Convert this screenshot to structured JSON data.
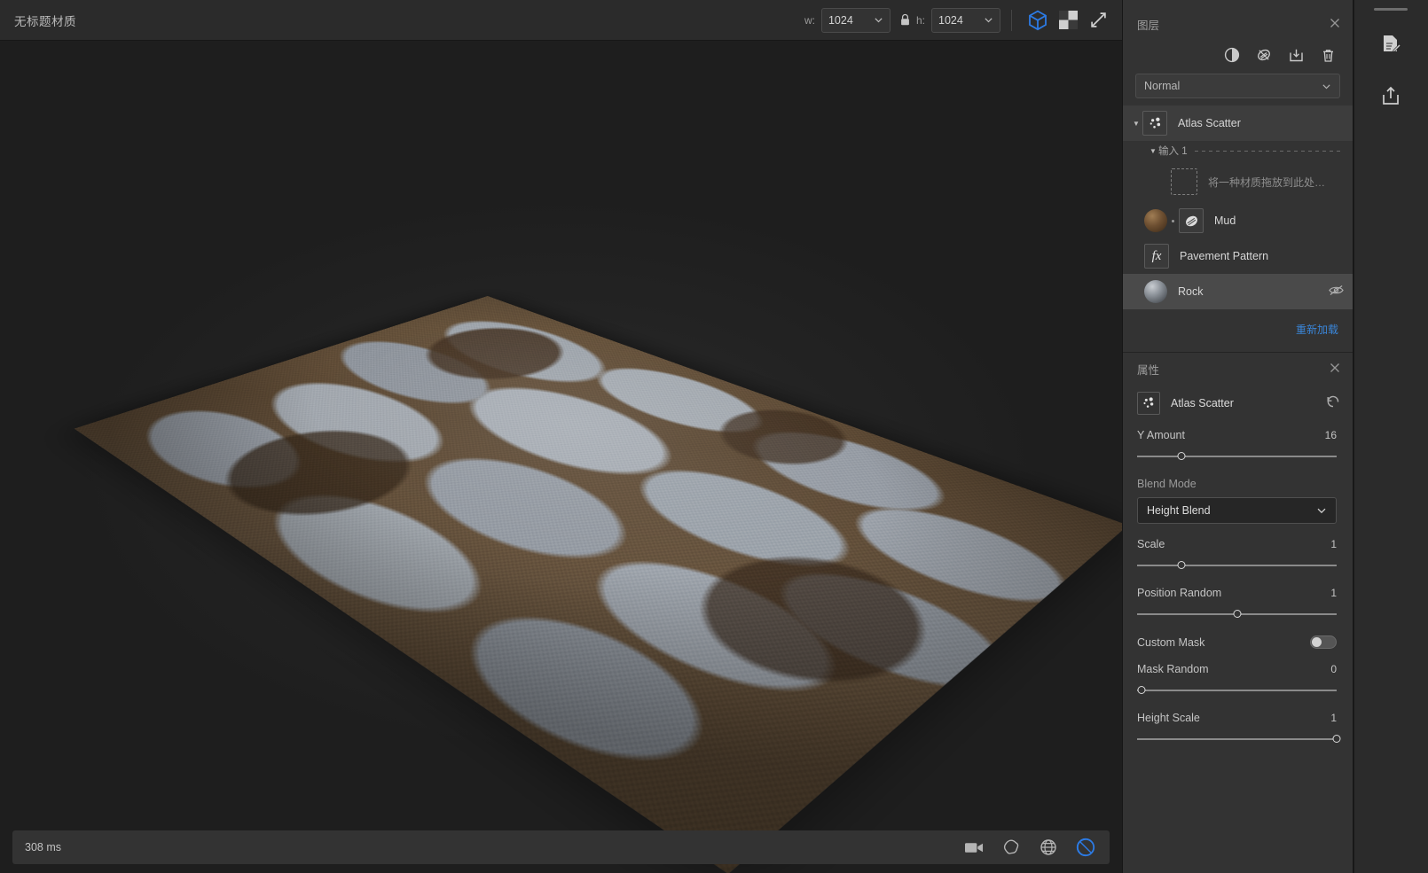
{
  "topbar": {
    "document_title": "无标题材质",
    "width_label": "w:",
    "width_value": "1024",
    "height_label": "h:",
    "height_value": "1024",
    "lock_icon": "lock-icon",
    "cube_icon": "3d-cube-icon",
    "checker_icon": "2d-checker-icon",
    "expand_icon": "expand-arrows-icon",
    "accent_color": "#2c7be5"
  },
  "viewport": {
    "status_text": "308 ms",
    "icons": [
      "camera-icon",
      "environment-icon",
      "globe-grid-icon",
      "render-toggle-icon"
    ]
  },
  "layers_panel": {
    "title": "图层",
    "close_label": "✕",
    "tools": [
      "adjustment-layer-icon",
      "mask-icon",
      "import-icon",
      "delete-icon"
    ],
    "blend_mode_value": "Normal",
    "items": [
      {
        "name": "Atlas Scatter",
        "icon": "atlas-scatter-icon",
        "type": "group",
        "selected": false
      },
      {
        "name": "Mud",
        "icon": "material-sphere-icon",
        "type": "material",
        "selected": false
      },
      {
        "name": "Pavement Pattern",
        "icon": "fx-icon",
        "type": "filter",
        "selected": false
      },
      {
        "name": "Rock",
        "icon": "material-sphere-icon",
        "type": "material",
        "selected": true
      }
    ],
    "input_group_label": "输入 1",
    "drop_zone_text": "将一种材质拖放到此处…",
    "reload_link": "重新加载"
  },
  "properties_panel": {
    "title": "属性",
    "close_label": "✕",
    "node_name": "Atlas Scatter",
    "node_icon": "atlas-scatter-icon",
    "reset_icon": "reset-icon",
    "params": [
      {
        "label": "Y Amount",
        "value": "16",
        "control": "slider",
        "percent": 22
      },
      {
        "label": "Blend Mode",
        "value": "Height Blend",
        "control": "select"
      },
      {
        "label": "Scale",
        "value": "1",
        "control": "slider",
        "percent": 22
      },
      {
        "label": "Position Random",
        "value": "1",
        "control": "slider",
        "percent": 50
      },
      {
        "label": "Custom Mask",
        "value": "",
        "control": "toggle",
        "on": false
      },
      {
        "label": "Mask Random",
        "value": "0",
        "control": "slider",
        "percent": 2
      },
      {
        "label": "Height Scale",
        "value": "1",
        "control": "slider",
        "percent": 100
      }
    ]
  },
  "rail": {
    "buttons": [
      "export-document-icon",
      "share-upload-icon"
    ]
  }
}
